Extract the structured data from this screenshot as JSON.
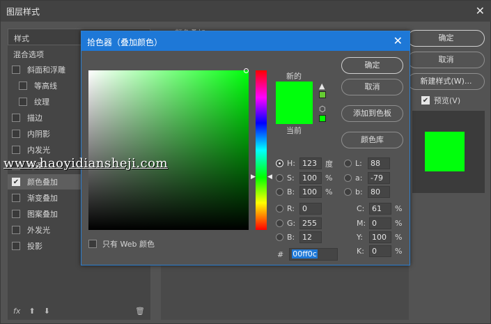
{
  "window": {
    "title": "图层样式"
  },
  "left_panel": {
    "header": "样式",
    "blend_options": "混合选项",
    "items": [
      {
        "label": "斜面和浮雕",
        "checked": false,
        "sub": false
      },
      {
        "label": "等高线",
        "checked": false,
        "sub": true
      },
      {
        "label": "纹理",
        "checked": false,
        "sub": true
      },
      {
        "label": "描边",
        "checked": false,
        "sub": false
      },
      {
        "label": "内阴影",
        "checked": false,
        "sub": false
      },
      {
        "label": "内发光",
        "checked": false,
        "sub": false
      },
      {
        "label": "光泽",
        "checked": false,
        "sub": false
      },
      {
        "label": "颜色叠加",
        "checked": true,
        "sub": false
      },
      {
        "label": "渐变叠加",
        "checked": false,
        "sub": false
      },
      {
        "label": "图案叠加",
        "checked": false,
        "sub": false
      },
      {
        "label": "外发光",
        "checked": false,
        "sub": false
      },
      {
        "label": "投影",
        "checked": false,
        "sub": false
      }
    ],
    "footer": {
      "fx": "fx"
    }
  },
  "middle": {
    "header": "颜色叠加"
  },
  "right_buttons": {
    "ok": "确定",
    "cancel": "取消",
    "new_style": "新建样式(W)...",
    "preview": "预览(V)"
  },
  "picker": {
    "title": "拾色器（叠加颜色）",
    "new_label": "新的",
    "current_label": "当前",
    "new_color": "#00ff0c",
    "current_color": "#00ff0c",
    "gamut_swatch": "#66cc33",
    "web_swatch": "#00ff00",
    "buttons": {
      "ok": "确定",
      "cancel": "取消",
      "add": "添加到色板",
      "library": "颜色库"
    },
    "web_only": "只有 Web 颜色",
    "hsb": {
      "h": {
        "label": "H:",
        "value": "123",
        "unit": "度"
      },
      "s": {
        "label": "S:",
        "value": "100",
        "unit": "%"
      },
      "b": {
        "label": "B:",
        "value": "100",
        "unit": "%"
      }
    },
    "rgb": {
      "r": {
        "label": "R:",
        "value": "0"
      },
      "g": {
        "label": "G:",
        "value": "255"
      },
      "b": {
        "label": "B:",
        "value": "12"
      }
    },
    "lab": {
      "l": {
        "label": "L:",
        "value": "88"
      },
      "a": {
        "label": "a:",
        "value": "-79"
      },
      "b": {
        "label": "b:",
        "value": "80"
      }
    },
    "cmyk": {
      "c": {
        "label": "C:",
        "value": "61",
        "unit": "%"
      },
      "m": {
        "label": "M:",
        "value": "0",
        "unit": "%"
      },
      "y": {
        "label": "Y:",
        "value": "100",
        "unit": "%"
      },
      "k": {
        "label": "K:",
        "value": "0",
        "unit": "%"
      }
    },
    "hex": {
      "label": "#",
      "value": "00ff0c"
    }
  },
  "watermark": "www.haoyidiansheji.com"
}
